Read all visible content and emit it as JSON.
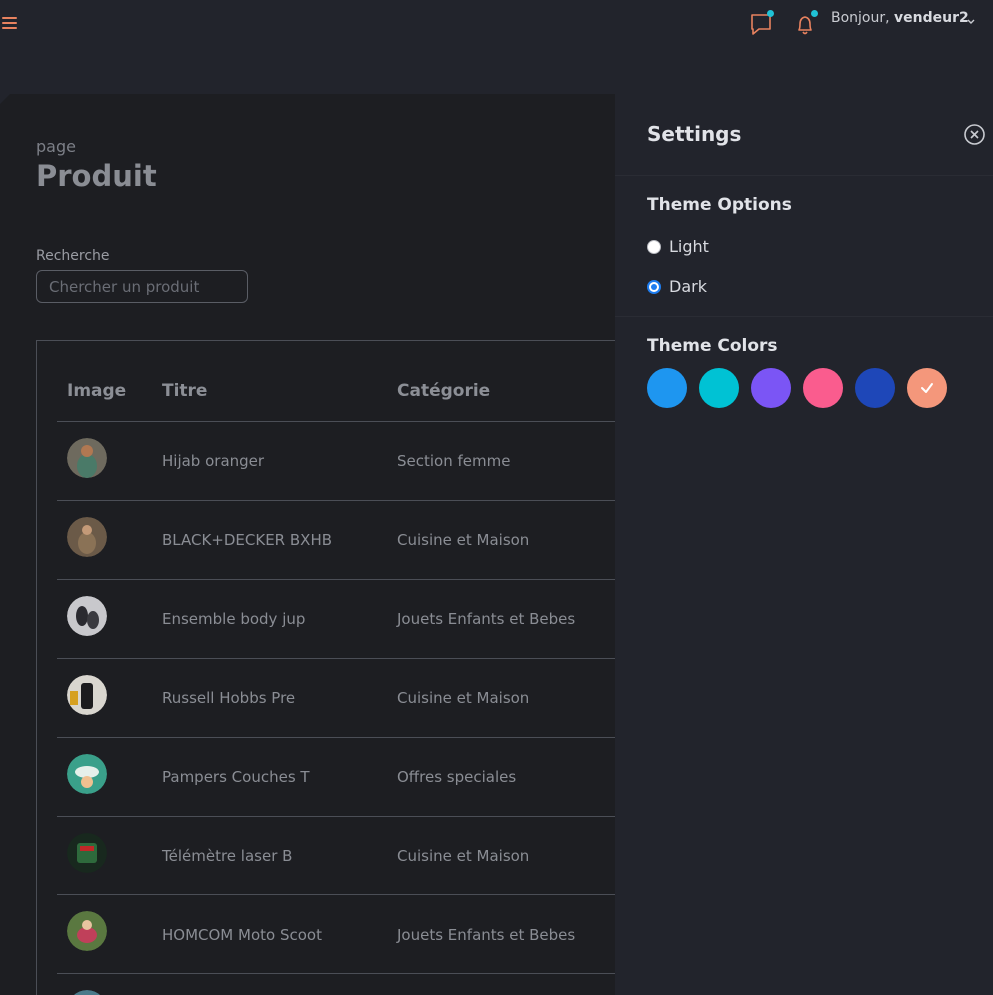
{
  "header": {
    "greeting_prefix": "Bonjour,",
    "username": "vendeur2",
    "icons": [
      "menu-icon",
      "chat-icon",
      "bell-icon",
      "chevron-down-icon"
    ],
    "accent_color": "#e8825f",
    "notification_dot_color": "#20c2d6"
  },
  "page": {
    "subtitle": "page",
    "title": "Produit"
  },
  "search": {
    "label": "Recherche",
    "placeholder": "Chercher un produit",
    "value": ""
  },
  "table": {
    "columns": [
      "Image",
      "Titre",
      "Catégorie"
    ],
    "rows": [
      {
        "titre": "Hijab oranger",
        "categorie": "Section femme"
      },
      {
        "titre": "BLACK+DECKER BXHB",
        "categorie": "Cuisine et Maison"
      },
      {
        "titre": "Ensemble body jup",
        "categorie": "Jouets Enfants et Bebes"
      },
      {
        "titre": "Russell Hobbs Pre",
        "categorie": "Cuisine et Maison"
      },
      {
        "titre": "Pampers Couches T",
        "categorie": "Offres speciales"
      },
      {
        "titre": "Télémètre laser B",
        "categorie": "Cuisine et Maison"
      },
      {
        "titre": "HOMCOM Moto Scoot",
        "categorie": "Jouets Enfants et Bebes"
      }
    ]
  },
  "settings": {
    "title": "Settings",
    "theme_options_title": "Theme Options",
    "options": [
      {
        "label": "Light",
        "checked": false
      },
      {
        "label": "Dark",
        "checked": true
      }
    ],
    "theme_colors_title": "Theme Colors",
    "colors": [
      "#1e96f0",
      "#00c2d4",
      "#7b55f5",
      "#fa5c8e",
      "#1e47b8",
      "#f4977b"
    ],
    "selected_color": "#f4977b"
  }
}
